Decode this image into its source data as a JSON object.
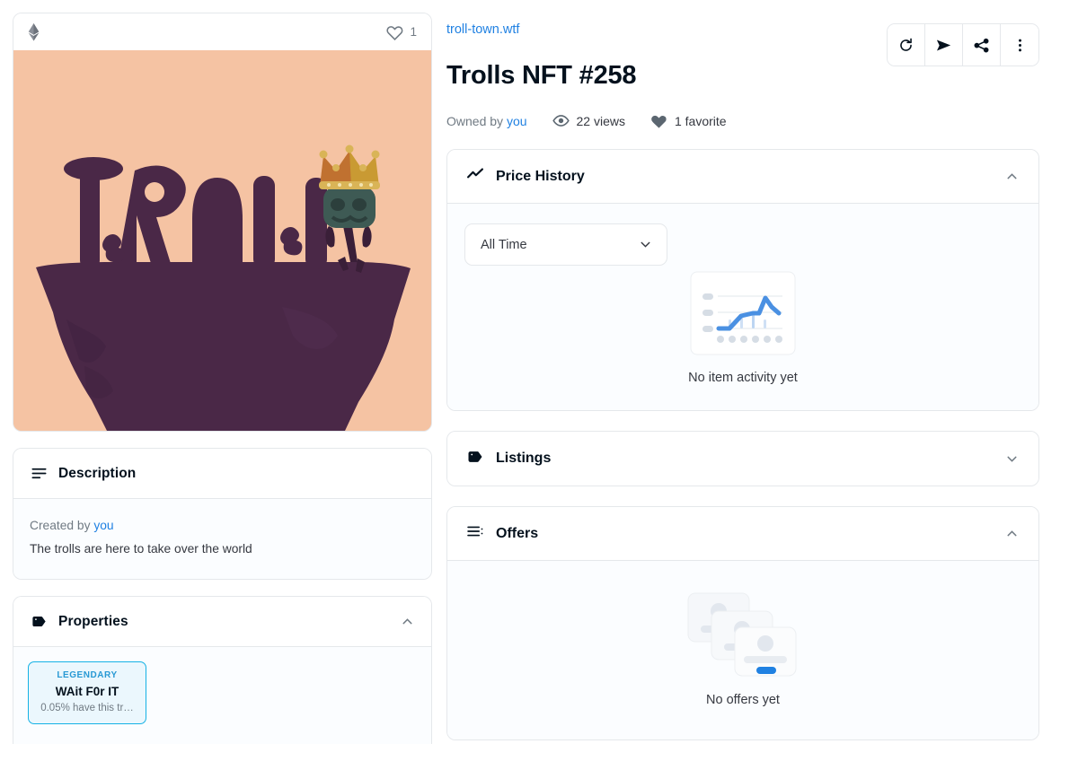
{
  "media": {
    "chain_icon": "ethereum-icon",
    "favorite_icon": "heart-outline-icon",
    "favorite_count": "1",
    "artwork_alt": "Trolls NFT #258 artwork",
    "artwork_word": "TROLL",
    "artwork_bg_color": "#f5c3a3",
    "artwork_silhouette_color": "#4a2847",
    "artwork_crown_color": "#c99a33"
  },
  "description": {
    "icon": "description-lines-icon",
    "title": "Description",
    "created_prefix": "Created by ",
    "created_by": "you",
    "body": "The trolls are here to take over the world"
  },
  "properties": {
    "icon": "tag-filled-icon",
    "title": "Properties",
    "collapse_icon": "chevron-up-icon",
    "traits": [
      {
        "type": "LEGENDARY",
        "value": "WAit F0r IT",
        "rarity": "0.05% have this tr…"
      }
    ]
  },
  "header": {
    "collection": "troll-town.wtf",
    "title": "Trolls NFT #258",
    "owned_prefix": "Owned by ",
    "owner": "you",
    "views_icon": "eye-icon",
    "views": "22 views",
    "favorites_icon": "heart-filled-icon",
    "favorites": "1 favorite",
    "actions": [
      {
        "name": "refresh-metadata-button",
        "icon": "refresh-icon"
      },
      {
        "name": "transfer-button",
        "icon": "send-icon"
      },
      {
        "name": "share-button",
        "icon": "share-icon"
      },
      {
        "name": "more-options-button",
        "icon": "ellipsis-vertical-icon"
      }
    ]
  },
  "price_history": {
    "icon": "trend-line-icon",
    "title": "Price History",
    "collapse_icon": "chevron-up-icon",
    "range_select": {
      "value": "All Time",
      "icon": "chevron-down-icon"
    },
    "empty_icon": "chart-placeholder-icon",
    "empty_text": "No item activity yet"
  },
  "listings": {
    "icon": "tag-filled-icon",
    "title": "Listings",
    "collapse_icon": "chevron-down-icon"
  },
  "offers": {
    "icon": "list-icon",
    "title": "Offers",
    "collapse_icon": "chevron-up-icon",
    "empty_icon": "stacked-cards-icon",
    "empty_text": "No offers yet"
  },
  "colors": {
    "link": "#2081e2",
    "text": "#04111d",
    "muted": "#707a83",
    "border": "#e5e8eb",
    "panel_bg": "#fbfdff",
    "trait_border": "#15b2e5",
    "trait_bg": "#ebf7fd",
    "accent_blue": "#4a90e2"
  }
}
